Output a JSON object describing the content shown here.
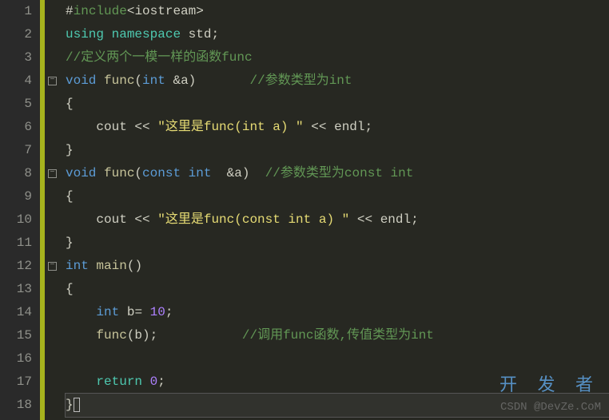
{
  "lines": {
    "n1": "1",
    "n2": "2",
    "n3": "3",
    "n4": "4",
    "n5": "5",
    "n6": "6",
    "n7": "7",
    "n8": "8",
    "n9": "9",
    "n10": "10",
    "n11": "11",
    "n12": "12",
    "n13": "13",
    "n14": "14",
    "n15": "15",
    "n16": "16",
    "n17": "17",
    "n18": "18"
  },
  "fold_marker": "−",
  "code": {
    "l1": {
      "hash": "#",
      "include": "include",
      "lt": "<",
      "hdr": "iostream",
      "gt": ">"
    },
    "l2": {
      "using": "using",
      "namespace": "namespace",
      "std": "std",
      "semi": ";"
    },
    "l3": {
      "cmt": "//定义两个一模一样的函数func"
    },
    "l4": {
      "void": "void",
      "func": "func",
      "lp": "(",
      "int": "int",
      "amp": "&",
      "a": "a",
      "rp": ")",
      "cmt": "//参数类型为int"
    },
    "l5": {
      "brace": "{"
    },
    "l6": {
      "cout": "cout",
      "lshift1": "<<",
      "str": "\"这里是func(int a) \"",
      "lshift2": "<<",
      "endl": "endl",
      "semi": ";"
    },
    "l7": {
      "brace": "}"
    },
    "l8": {
      "void": "void",
      "func": "func",
      "lp": "(",
      "const": "const",
      "int": "int",
      "amp": "&",
      "a": "a",
      "rp": ")",
      "cmt": "//参数类型为const int"
    },
    "l9": {
      "brace": "{"
    },
    "l10": {
      "cout": "cout",
      "lshift1": "<<",
      "str": "\"这里是func(const int a) \"",
      "lshift2": "<<",
      "endl": "endl",
      "semi": ";"
    },
    "l11": {
      "brace": "}"
    },
    "l12": {
      "int": "int",
      "main": "main",
      "lp": "(",
      "rp": ")"
    },
    "l13": {
      "brace": "{"
    },
    "l14": {
      "int": "int",
      "b": "b",
      "eq": "=",
      "num": "10",
      "semi": ";"
    },
    "l15": {
      "func": "func",
      "lp": "(",
      "b": "b",
      "rp": ")",
      "semi": ";",
      "cmt": "//调用func函数,传值类型为int"
    },
    "l16": {},
    "l17": {
      "return": "return",
      "num": "0",
      "semi": ";"
    },
    "l18": {
      "brace": "}"
    }
  },
  "watermark": {
    "top": "开 发 者",
    "bottom": "CSDN @DevZe.CoM"
  }
}
